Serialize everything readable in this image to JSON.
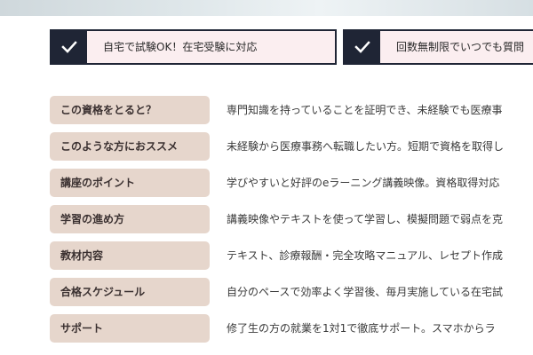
{
  "features": [
    {
      "text": "自宅で試験OK！在宅受験に対応",
      "icon": "check-icon"
    },
    {
      "text": "回数無制限でいつでも質問",
      "icon": "check-icon"
    }
  ],
  "rows": [
    {
      "label": "この資格をとると？",
      "value": "専門知識を持っていることを証明でき、未経験でも医療事"
    },
    {
      "label": "このような方におススメ",
      "value": "未経験から医療事務へ転職したい方。短期で資格を取得し"
    },
    {
      "label": "講座のポイント",
      "value": "学びやすいと好評のeラーニング講義映像。資格取得対応"
    },
    {
      "label": "学習の進め方",
      "value": "講義映像やテキストを使って学習し、模擬問題で弱点を克"
    },
    {
      "label": "教材内容",
      "value": "テキスト、診療報酬・完全攻略マニュアル、レセプト作成"
    },
    {
      "label": "合格スケジュール",
      "value": "自分のペースで効率よく学習後、毎月実施している在宅試"
    },
    {
      "label": "サポート",
      "value": "修了生の方の就業を1対1で徹底サポート。スマホからラ"
    }
  ],
  "colors": {
    "navy": "#1f2535",
    "feature_bg": "#fbeef0",
    "label_bg": "#e6d6cc"
  }
}
